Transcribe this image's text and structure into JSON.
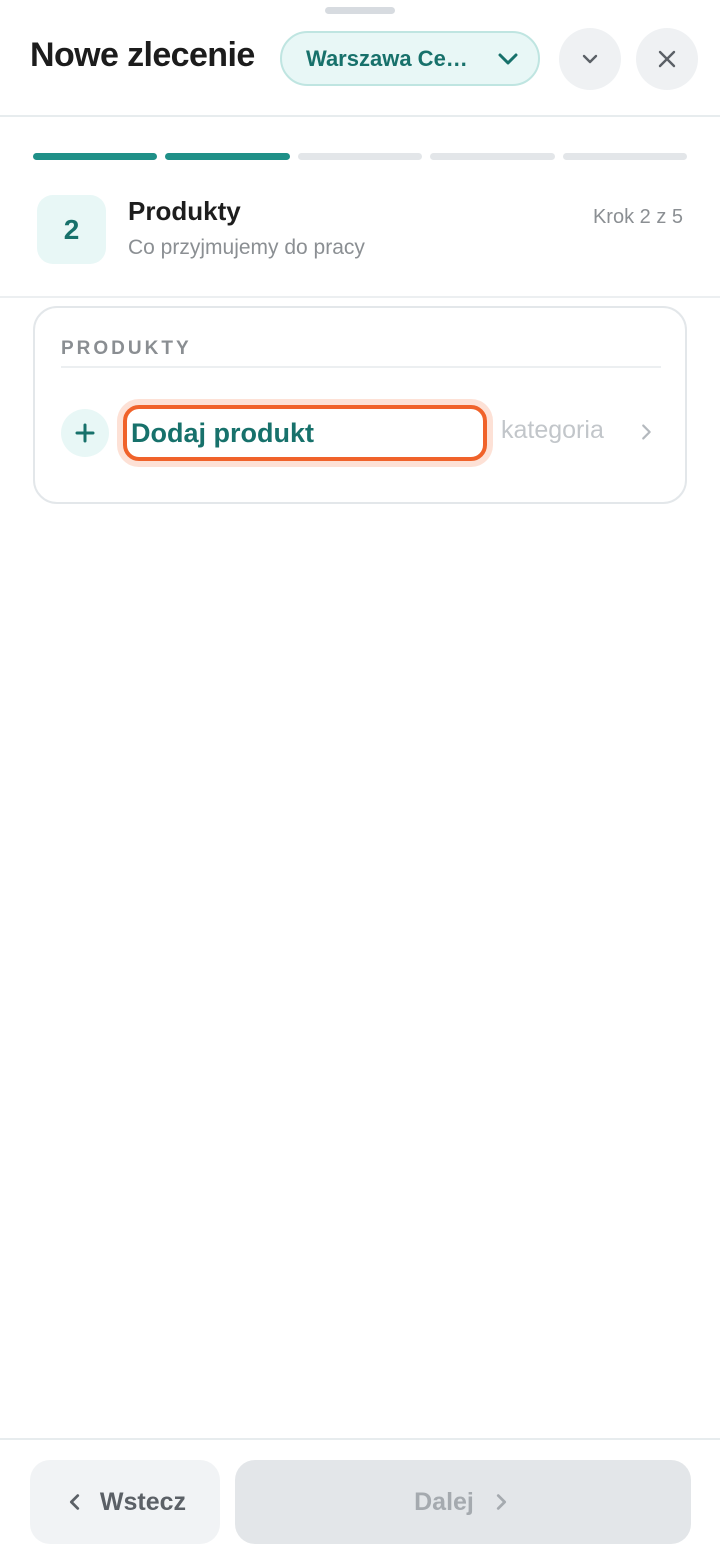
{
  "header": {
    "title": "Nowe zlecenie",
    "branch_selector": "Warszawa Ce…",
    "icons": {
      "branch": "chevron-down-icon",
      "collapse": "chevron-down-icon",
      "close": "close-icon"
    }
  },
  "progress": {
    "total_steps": 5,
    "current_step": 2
  },
  "step": {
    "number": "2",
    "title": "Produkty",
    "subtitle": "Co przyjmujemy do pracy",
    "counter": "Krok 2 z 5"
  },
  "card": {
    "section_label": "PRODUKTY",
    "add_product_label": "Dodaj produkt",
    "category_placeholder": "kategoria",
    "icons": {
      "add": "plus-icon",
      "category": "chevron-right-icon"
    }
  },
  "footer": {
    "back_label": "Wstecz",
    "next_label": "Dalej",
    "next_disabled": true
  },
  "colors": {
    "accent": "#17716b",
    "progress_active": "#1f9088",
    "focus_outline": "#f0622a",
    "badge_bg": "#e8f7f6"
  }
}
